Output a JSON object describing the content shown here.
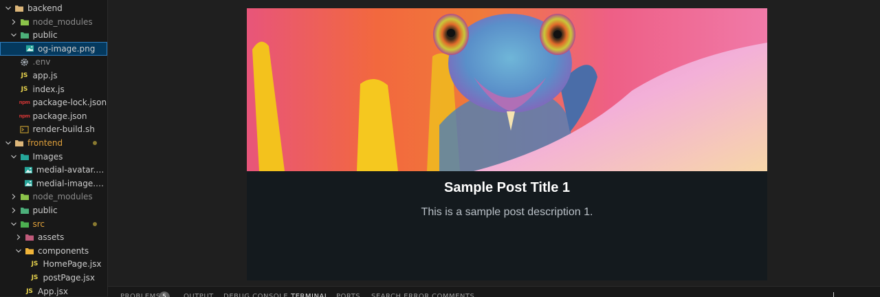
{
  "explorer": {
    "items": [
      {
        "label": "backend",
        "kind": "folder-open",
        "indent": 0
      },
      {
        "label": "node_modules",
        "kind": "folder-node",
        "indent": 1,
        "muted": true
      },
      {
        "label": "public",
        "kind": "folder-public-open",
        "indent": 1
      },
      {
        "label": "og-image.png",
        "kind": "image",
        "indent": 2,
        "selected": true
      },
      {
        "label": ".env",
        "kind": "gear",
        "indent": 1,
        "muted": true
      },
      {
        "label": "app.js",
        "kind": "js",
        "indent": 1
      },
      {
        "label": "index.js",
        "kind": "js",
        "indent": 1
      },
      {
        "label": "package-lock.json",
        "kind": "npm",
        "indent": 1
      },
      {
        "label": "package.json",
        "kind": "npm",
        "indent": 1
      },
      {
        "label": "render-build.sh",
        "kind": "terminal",
        "indent": 1
      },
      {
        "label": "frontend",
        "kind": "folder-open",
        "indent": 0,
        "modified": true
      },
      {
        "label": "Images",
        "kind": "folder-images-open",
        "indent": 1
      },
      {
        "label": "medial-avatar.we...",
        "kind": "image",
        "indent": 2
      },
      {
        "label": "medial-image.we...",
        "kind": "image",
        "indent": 2
      },
      {
        "label": "node_modules",
        "kind": "folder-node",
        "indent": 1,
        "muted": true
      },
      {
        "label": "public",
        "kind": "folder-public",
        "indent": 1
      },
      {
        "label": "src",
        "kind": "folder-src-open",
        "indent": 1,
        "modified": true
      },
      {
        "label": "assets",
        "kind": "folder-assets",
        "indent": 2
      },
      {
        "label": "components",
        "kind": "folder-components-open",
        "indent": 2
      },
      {
        "label": "HomePage.jsx",
        "kind": "js",
        "indent": 3
      },
      {
        "label": "postPage.jsx",
        "kind": "js",
        "indent": 3
      },
      {
        "label": "App.jsx",
        "kind": "js",
        "indent": 2
      }
    ],
    "js_icon_text": "JS",
    "npm_icon_text": "npm"
  },
  "post": {
    "title": "Sample Post Title 1",
    "description": "This is a sample post description 1.",
    "image_alt": "chameleon-hero-image"
  },
  "panel": {
    "tabs": [
      "PROBLEMS",
      "OUTPUT",
      "DEBUG CONSOLE",
      "TERMINAL",
      "PORTS",
      "SEARCH ERROR",
      "COMMENTS"
    ],
    "problems_count": "5",
    "active_tab": "TERMINAL"
  },
  "colors": {
    "selected_bg": "#04395e",
    "modified": "#e2a23b",
    "folder": "#dcb67a",
    "js": "#e8d44d"
  }
}
